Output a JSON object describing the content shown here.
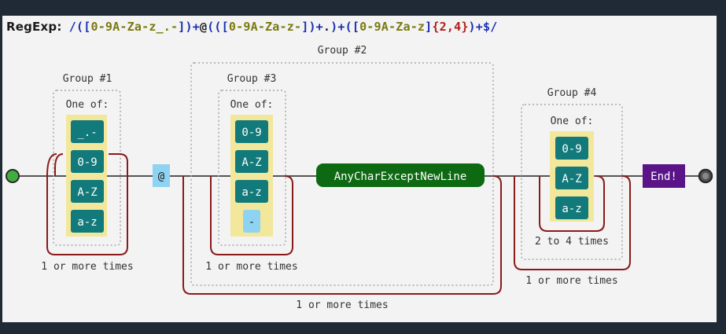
{
  "header": {
    "label": "RegExp:",
    "tokens": [
      {
        "t": "/(",
        "k": "op"
      },
      {
        "t": "[",
        "k": "br"
      },
      {
        "t": "0-9A-Za-z_.-",
        "k": "cls"
      },
      {
        "t": "]",
        "k": "br"
      },
      {
        "t": ")+",
        "k": "op"
      },
      {
        "t": "@",
        "k": "lit"
      },
      {
        "t": "((",
        "k": "op"
      },
      {
        "t": "[",
        "k": "br"
      },
      {
        "t": "0-9A-Za-z-",
        "k": "cls"
      },
      {
        "t": "]",
        "k": "br"
      },
      {
        "t": ")+",
        "k": "op"
      },
      {
        "t": ".",
        "k": "lit"
      },
      {
        "t": ")+(",
        "k": "op"
      },
      {
        "t": "[",
        "k": "br"
      },
      {
        "t": "0-9A-Za-z",
        "k": "cls"
      },
      {
        "t": "]",
        "k": "br"
      },
      {
        "t": "{2,4}",
        "k": "num"
      },
      {
        "t": ")+$/",
        "k": "op"
      }
    ]
  },
  "groups": {
    "g1": "Group #1",
    "g2": "Group #2",
    "g3": "Group #3",
    "g4": "Group #4"
  },
  "oneof": {
    "g1": "One of:",
    "g3": "One of:",
    "g4": "One of:"
  },
  "classes": {
    "g1": [
      "_.-",
      "0-9",
      "A-Z",
      "a-z"
    ],
    "g3": [
      "0-9",
      "A-Z",
      "a-z",
      "-"
    ],
    "g4": [
      "0-9",
      "A-Z",
      "a-z"
    ]
  },
  "nodes": {
    "at": "@",
    "anychar": "AnyCharExceptNewLine",
    "end": "End!"
  },
  "repeats": {
    "g1": "1 or more times",
    "g3": "1 or more times",
    "g2": "1 or more times",
    "g4_inner": "2 to 4 times",
    "g4_outer": "1 or more times"
  },
  "colors": {
    "bg": "#1f2a36",
    "panel": "#f3f3f3",
    "charset_bg": "#f2e79a",
    "class_teal": "#127a7a",
    "literal_blue": "#8fd3f2",
    "anychar_green": "#0e6a12",
    "end_purple": "#5a1487",
    "loop_red": "#8a1a1a",
    "group_dotted": "#a8a8a8",
    "start_green": "#3fae3f"
  }
}
